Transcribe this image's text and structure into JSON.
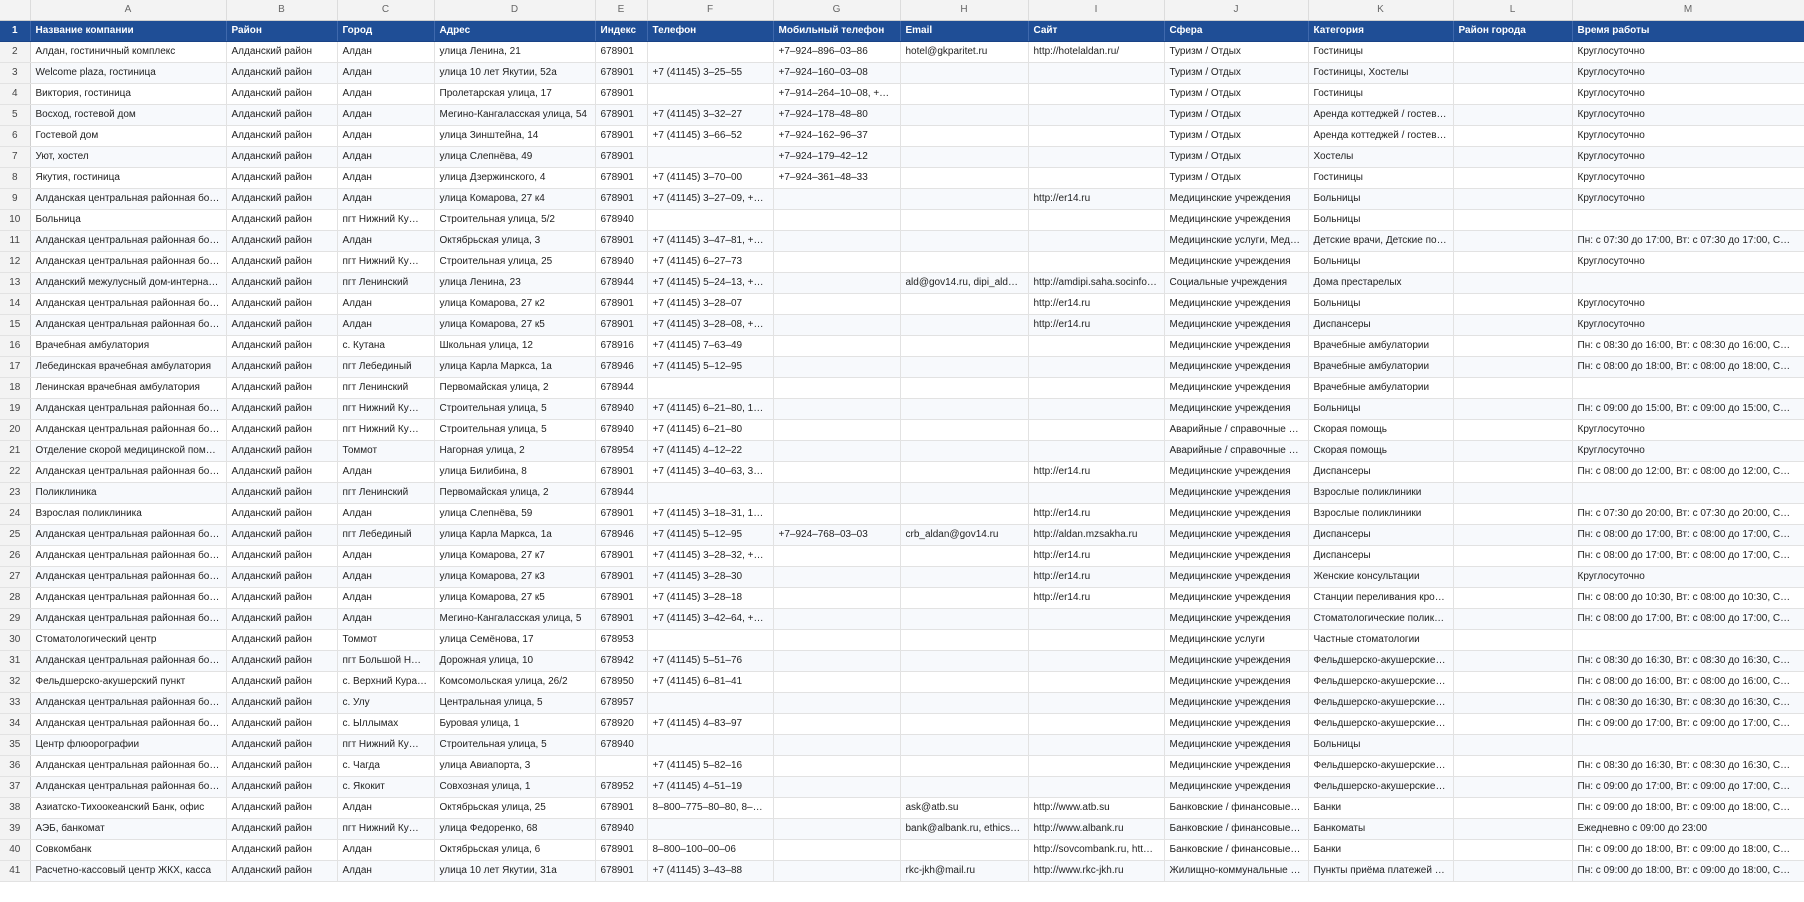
{
  "columns": [
    "A",
    "B",
    "C",
    "D",
    "E",
    "F",
    "G",
    "H",
    "I",
    "J",
    "K",
    "L",
    "M"
  ],
  "header_row": {
    "number": "1",
    "cells": [
      "Название компании",
      "Район",
      "Город",
      "Адрес",
      "Индекс",
      "Телефон",
      "Мобильный телефон",
      "Email",
      "Сайт",
      "Сфера",
      "Категория",
      "Район города",
      "Время работы"
    ]
  },
  "rows": [
    {
      "n": "2",
      "c": [
        "Алдан, гостиничный комплекс",
        "Алданский район",
        "Алдан",
        "улица Ленина, 21",
        "678901",
        "",
        "+7‒924‒896‒03‒86",
        "hotel@gkparitet.ru",
        "http://hotelaldan.ru/",
        "Туризм / Отдых",
        "Гостиницы",
        "",
        "Круглосуточно"
      ]
    },
    {
      "n": "3",
      "c": [
        "Welcome plaza, гостиница",
        "Алданский район",
        "Алдан",
        "улица 10 лет Якутии, 52а",
        "678901",
        "+7 (41145) 3‒25‒55",
        "+7‒924‒160‒03‒08",
        "",
        "",
        "Туризм / Отдых",
        "Гостиницы, Хостелы",
        "",
        "Круглосуточно"
      ]
    },
    {
      "n": "4",
      "c": [
        "Виктория, гостиница",
        "Алданский район",
        "Алдан",
        "Пролетарская улица, 17",
        "678901",
        "",
        "+7‒914‒264‒10‒08, +7…",
        "",
        "",
        "Туризм / Отдых",
        "Гостиницы",
        "",
        "Круглосуточно"
      ]
    },
    {
      "n": "5",
      "c": [
        "Восход, гостевой дом",
        "Алданский район",
        "Алдан",
        "Мегино-Кангаласская улица, 54",
        "678901",
        "+7 (41145) 3‒32‒27",
        "+7‒924‒178‒48‒80",
        "",
        "",
        "Туризм / Отдых",
        "Аренда коттеджей / гостев…",
        "",
        "Круглосуточно"
      ]
    },
    {
      "n": "6",
      "c": [
        "Гостевой дом",
        "Алданский район",
        "Алдан",
        "улица Зинштейна, 14",
        "678901",
        "+7 (41145) 3‒66‒52",
        "+7‒924‒162‒96‒37",
        "",
        "",
        "Туризм / Отдых",
        "Аренда коттеджей / гостев…",
        "",
        "Круглосуточно"
      ]
    },
    {
      "n": "7",
      "c": [
        "Уют, хостел",
        "Алданский район",
        "Алдан",
        "улица Слепнёва, 49",
        "678901",
        "",
        "+7‒924‒179‒42‒12",
        "",
        "",
        "Туризм / Отдых",
        "Хостелы",
        "",
        "Круглосуточно"
      ]
    },
    {
      "n": "8",
      "c": [
        "Якутия, гостиница",
        "Алданский район",
        "Алдан",
        "улица Дзержинского, 4",
        "678901",
        "+7 (41145) 3‒70‒00",
        "+7‒924‒361‒48‒33",
        "",
        "",
        "Туризм / Отдых",
        "Гостиницы",
        "",
        "Круглосуточно"
      ]
    },
    {
      "n": "9",
      "c": [
        "Алданская центральная районная бо…",
        "Алданский район",
        "Алдан",
        "улица Комарова, 27 к4",
        "678901",
        "+7 (41145) 3‒27‒09, +7…",
        "",
        "",
        "http://er14.ru",
        "Медицинские учреждения",
        "Больницы",
        "",
        "Круглосуточно"
      ]
    },
    {
      "n": "10",
      "c": [
        "Больница",
        "Алданский район",
        "пгт Нижний Ку…",
        "Строительная улица, 5/2",
        "678940",
        "",
        "",
        "",
        "",
        "Медицинские учреждения",
        "Больницы",
        "",
        ""
      ]
    },
    {
      "n": "11",
      "c": [
        "Алданская центральная районная бо…",
        "Алданский район",
        "Алдан",
        "Октябрьская улица, 3",
        "678901",
        "+7 (41145) 3‒47‒81, +7…",
        "",
        "",
        "",
        "Медицинские услуги, Мед…",
        "Детские врачи, Детские по…",
        "",
        "Пн: с 07:30 до 17:00, Вт: с 07:30 до 17:00, С…"
      ]
    },
    {
      "n": "12",
      "c": [
        "Алданская центральная районная бо…",
        "Алданский район",
        "пгт Нижний Ку…",
        "Строительная улица, 25",
        "678940",
        "+7 (41145) 6‒27‒73",
        "",
        "",
        "",
        "Медицинские учреждения",
        "Больницы",
        "",
        "Круглосуточно"
      ]
    },
    {
      "n": "13",
      "c": [
        "Алданский межулусный дом-интерна…",
        "Алданский район",
        "пгт Ленинский",
        "улица Ленина, 23",
        "678944",
        "+7 (41145) 5‒24‒13, +7…",
        "",
        "ald@gov14.ru, dipi_ald…",
        "http://amdipi.saha.socinfo…",
        "Социальные учреждения",
        "Дома престарелых",
        "",
        ""
      ]
    },
    {
      "n": "14",
      "c": [
        "Алданская центральная районная бо…",
        "Алданский район",
        "Алдан",
        "улица Комарова, 27 к2",
        "678901",
        "+7 (41145) 3‒28‒07",
        "",
        "",
        "http://er14.ru",
        "Медицинские учреждения",
        "Больницы",
        "",
        "Круглосуточно"
      ]
    },
    {
      "n": "15",
      "c": [
        "Алданская центральная районная бо…",
        "Алданский район",
        "Алдан",
        "улица Комарова, 27 к5",
        "678901",
        "+7 (41145) 3‒28‒08, +7…",
        "",
        "",
        "http://er14.ru",
        "Медицинские учреждения",
        "Диспансеры",
        "",
        "Круглосуточно"
      ]
    },
    {
      "n": "16",
      "c": [
        "Врачебная амбулатория",
        "Алданский район",
        "с. Кутана",
        "Школьная улица, 12",
        "678916",
        "+7 (41145) 7‒63‒49",
        "",
        "",
        "",
        "Медицинские учреждения",
        "Врачебные амбулатории",
        "",
        "Пн: с 08:30 до 16:00, Вт: с 08:30 до 16:00, С…"
      ]
    },
    {
      "n": "17",
      "c": [
        "Лебединская врачебная амбулатория",
        "Алданский район",
        "пгт Лебединый",
        "улица Карла Маркса, 1а",
        "678946",
        "+7 (41145) 5‒12‒95",
        "",
        "",
        "",
        "Медицинские учреждения",
        "Врачебные амбулатории",
        "",
        "Пн: с 08:00 до 18:00, Вт: с 08:00 до 18:00, С…"
      ]
    },
    {
      "n": "18",
      "c": [
        "Ленинская врачебная амбулатория",
        "Алданский район",
        "пгт Ленинский",
        "Первомайская улица, 2",
        "678944",
        "",
        "",
        "",
        "",
        "Медицинские учреждения",
        "Врачебные амбулатории",
        "",
        ""
      ]
    },
    {
      "n": "19",
      "c": [
        "Алданская центральная районная бо…",
        "Алданский район",
        "пгт Нижний Ку…",
        "Строительная улица, 5",
        "678940",
        "+7 (41145) 6‒21‒80, 1‒…",
        "",
        "",
        "",
        "Медицинские учреждения",
        "Больницы",
        "",
        "Пн: с 09:00 до 15:00, Вт: с 09:00 до 15:00, С…"
      ]
    },
    {
      "n": "20",
      "c": [
        "Алданская центральная районная бо…",
        "Алданский район",
        "пгт Нижний Ку…",
        "Строительная улица, 5",
        "678940",
        "+7 (41145) 6‒21‒80",
        "",
        "",
        "",
        "Аварийные / справочные …",
        "Скорая помощь",
        "",
        "Круглосуточно"
      ]
    },
    {
      "n": "21",
      "c": [
        "Отделение скорой медицинской пом…",
        "Алданский район",
        "Томмот",
        "Нагорная улица, 2",
        "678954",
        "+7 (41145) 4‒12‒22",
        "",
        "",
        "",
        "Аварийные / справочные …",
        "Скорая помощь",
        "",
        "Круглосуточно"
      ]
    },
    {
      "n": "22",
      "c": [
        "Алданская центральная районная бо…",
        "Алданский район",
        "Алдан",
        "улица Билибина, 8",
        "678901",
        "+7 (41145) 3‒40‒63, 3‒…",
        "",
        "",
        "http://er14.ru",
        "Медицинские учреждения",
        "Диспансеры",
        "",
        "Пн: с 08:00 до 12:00, Вт: с 08:00 до 12:00, С…"
      ]
    },
    {
      "n": "23",
      "c": [
        "Поликлиника",
        "Алданский район",
        "пгт Ленинский",
        "Первомайская улица, 2",
        "678944",
        "",
        "",
        "",
        "",
        "Медицинские учреждения",
        "Взрослые поликлиники",
        "",
        ""
      ]
    },
    {
      "n": "24",
      "c": [
        "Взрослая поликлиника",
        "Алданский район",
        "Алдан",
        "улица Слепнёва, 59",
        "678901",
        "+7 (41145) 3‒18‒31, 1‒…",
        "",
        "",
        "http://er14.ru",
        "Медицинские учреждения",
        "Взрослые поликлиники",
        "",
        "Пн: с 07:30 до 20:00, Вт: с 07:30 до 20:00, С…"
      ]
    },
    {
      "n": "25",
      "c": [
        "Алданская центральная районная бо…",
        "Алданский район",
        "пгт Лебединый",
        "улица Карла Маркса, 1а",
        "678946",
        "+7 (41145) 5‒12‒95",
        "+7‒924‒768‒03‒03",
        "crb_aldan@gov14.ru",
        "http://aldan.mzsakha.ru",
        "Медицинские учреждения",
        "Диспансеры",
        "",
        "Пн: с 08:00 до 17:00, Вт: с 08:00 до 17:00, С…"
      ]
    },
    {
      "n": "26",
      "c": [
        "Алданская центральная районная бо…",
        "Алданский район",
        "Алдан",
        "улица Комарова, 27 к7",
        "678901",
        "+7 (41145) 3‒28‒32, +7…",
        "",
        "",
        "http://er14.ru",
        "Медицинские учреждения",
        "Диспансеры",
        "",
        "Пн: с 08:00 до 17:00, Вт: с 08:00 до 17:00, С…"
      ]
    },
    {
      "n": "27",
      "c": [
        "Алданская центральная районная бо…",
        "Алданский район",
        "Алдан",
        "улица Комарова, 27 к3",
        "678901",
        "+7 (41145) 3‒28‒30",
        "",
        "",
        "http://er14.ru",
        "Медицинские учреждения",
        "Женские консультации",
        "",
        "Круглосуточно"
      ]
    },
    {
      "n": "28",
      "c": [
        "Алданская центральная районная бо…",
        "Алданский район",
        "Алдан",
        "улица Комарова, 27 к5",
        "678901",
        "+7 (41145) 3‒28‒18",
        "",
        "",
        "http://er14.ru",
        "Медицинские учреждения",
        "Станции переливания кро…",
        "",
        "Пн: с 08:00 до 10:30, Вт: с 08:00 до 10:30, С…"
      ]
    },
    {
      "n": "29",
      "c": [
        "Алданская центральная районная бо…",
        "Алданский район",
        "Алдан",
        "Мегино-Кангаласская улица, 5",
        "678901",
        "+7 (41145) 3‒42‒64, +7…",
        "",
        "",
        "",
        "Медицинские учреждения",
        "Стоматологические полик…",
        "",
        "Пн: с 08:00 до 17:00, Вт: с 08:00 до 17:00, С…"
      ]
    },
    {
      "n": "30",
      "c": [
        "Стоматологический центр",
        "Алданский район",
        "Томмот",
        "улица Семёнова, 17",
        "678953",
        "",
        "",
        "",
        "",
        "Медицинские услуги",
        "Частные стоматологии",
        "",
        ""
      ]
    },
    {
      "n": "31",
      "c": [
        "Алданская центральная районная бо…",
        "Алданский район",
        "пгт Большой Н…",
        "Дорожная улица, 10",
        "678942",
        "+7 (41145) 5‒51‒76",
        "",
        "",
        "",
        "Медицинские учреждения",
        "Фельдшерско-акушерские…",
        "",
        "Пн: с 08:30 до 16:30, Вт: с 08:30 до 16:30, С…"
      ]
    },
    {
      "n": "32",
      "c": [
        "Фельдшерско-акушерский пункт",
        "Алданский район",
        "с. Верхний Кура…",
        "Комсомольская улица, 26/2",
        "678950",
        "+7 (41145) 6‒81‒41",
        "",
        "",
        "",
        "Медицинские учреждения",
        "Фельдшерско-акушерские…",
        "",
        "Пн: с 08:00 до 16:00, Вт: с 08:00 до 16:00, С…"
      ]
    },
    {
      "n": "33",
      "c": [
        "Алданская центральная районная бо…",
        "Алданский район",
        "с. Улу",
        "Центральная улица, 5",
        "678957",
        "",
        "",
        "",
        "",
        "Медицинские учреждения",
        "Фельдшерско-акушерские…",
        "",
        "Пн: с 08:30 до 16:30, Вт: с 08:30 до 16:30, С…"
      ]
    },
    {
      "n": "34",
      "c": [
        "Алданская центральная районная бо…",
        "Алданский район",
        "с. Ыллымах",
        "Буровая улица, 1",
        "678920",
        "+7 (41145) 4‒83‒97",
        "",
        "",
        "",
        "Медицинские учреждения",
        "Фельдшерско-акушерские…",
        "",
        "Пн: с 09:00 до 17:00, Вт: с 09:00 до 17:00, С…"
      ]
    },
    {
      "n": "35",
      "c": [
        "Центр флюорографии",
        "Алданский район",
        "пгт Нижний Ку…",
        "Строительная улица, 5",
        "678940",
        "",
        "",
        "",
        "",
        "Медицинские учреждения",
        "Больницы",
        "",
        ""
      ]
    },
    {
      "n": "36",
      "c": [
        "Алданская центральная районная бо…",
        "Алданский район",
        "с. Чагда",
        "улица Авиапорта, 3",
        "",
        "+7 (41145) 5‒82‒16",
        "",
        "",
        "",
        "Медицинские учреждения",
        "Фельдшерско-акушерские…",
        "",
        "Пн: с 08:30 до 16:30, Вт: с 08:30 до 16:30, С…"
      ]
    },
    {
      "n": "37",
      "c": [
        "Алданская центральная районная бо…",
        "Алданский район",
        "с. Якокит",
        "Совхозная улица, 1",
        "678952",
        "+7 (41145) 4‒51‒19",
        "",
        "",
        "",
        "Медицинские учреждения",
        "Фельдшерско-акушерские…",
        "",
        "Пн: с 09:00 до 17:00, Вт: с 09:00 до 17:00, С…"
      ]
    },
    {
      "n": "38",
      "c": [
        "Азиатско-Тихоокеанский Банк, офис",
        "Алданский район",
        "Алдан",
        "Октябрьская улица, 25",
        "678901",
        "8‒800‒775‒80‒80, 8‒8…",
        "",
        "ask@atb.su",
        "http://www.atb.su",
        "Банковские / финансовые …",
        "Банки",
        "",
        "Пн: с 09:00 до 18:00, Вт: с 09:00 до 18:00, С…"
      ]
    },
    {
      "n": "39",
      "c": [
        "АЭБ, банкомат",
        "Алданский район",
        "пгт Нижний Ку…",
        "улица Федоренко, 68",
        "678940",
        "",
        "",
        "bank@albank.ru, ethics…",
        "http://www.albank.ru",
        "Банковские / финансовые …",
        "Банкоматы",
        "",
        "Ежедневно с 09:00 до 23:00"
      ]
    },
    {
      "n": "40",
      "c": [
        "Совкомбанк",
        "Алданский район",
        "Алдан",
        "Октябрьская улица, 6",
        "678901",
        "8‒800‒100‒00‒06",
        "",
        "",
        "http://sovcombank.ru, htt…",
        "Банковские / финансовые …",
        "Банки",
        "",
        "Пн: с 09:00 до 18:00, Вт: с 09:00 до 18:00, С…"
      ]
    },
    {
      "n": "41",
      "c": [
        "Расчетно-кассовый центр ЖКХ, касса",
        "Алданский район",
        "Алдан",
        "улица 10 лет Якутии, 31а",
        "678901",
        "+7 (41145) 3‒43‒88",
        "",
        "rkc-jkh@mail.ru",
        "http://www.rkc-jkh.ru",
        "Жилищно-коммунальные …",
        "Пункты приёма платежей …",
        "",
        "Пн: с 09:00 до 18:00, Вт: с 09:00 до 18:00, С…"
      ]
    }
  ]
}
